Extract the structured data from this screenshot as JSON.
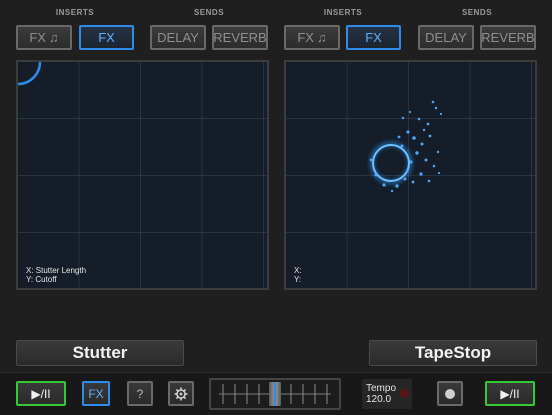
{
  "left_deck": {
    "inserts_label": "INSERTS",
    "sends_label": "SENDS",
    "fx_music_label": "FX",
    "fx_label": "FX",
    "delay_label": "DELAY",
    "reverb_label": "REVERB",
    "pad": {
      "x_label": "X: Stutter Length",
      "y_label": "Y: Cutoff"
    },
    "effect_name": "Stutter"
  },
  "right_deck": {
    "inserts_label": "INSERTS",
    "sends_label": "SENDS",
    "fx_music_label": "FX",
    "fx_label": "FX",
    "delay_label": "DELAY",
    "reverb_label": "REVERB",
    "pad": {
      "x_label": "X:",
      "y_label": "Y:"
    },
    "effect_name": "TapeStop"
  },
  "transport": {
    "play_pause_left": "▶/II",
    "fx_label": "FX",
    "help_label": "?",
    "tempo_label": "Tempo",
    "tempo_value": "120.0",
    "play_pause_right": "▶/II"
  },
  "colors": {
    "accent": "#2e8be8",
    "play": "#36c936",
    "pad_bg": "#141d28",
    "record": "#7a1818"
  }
}
